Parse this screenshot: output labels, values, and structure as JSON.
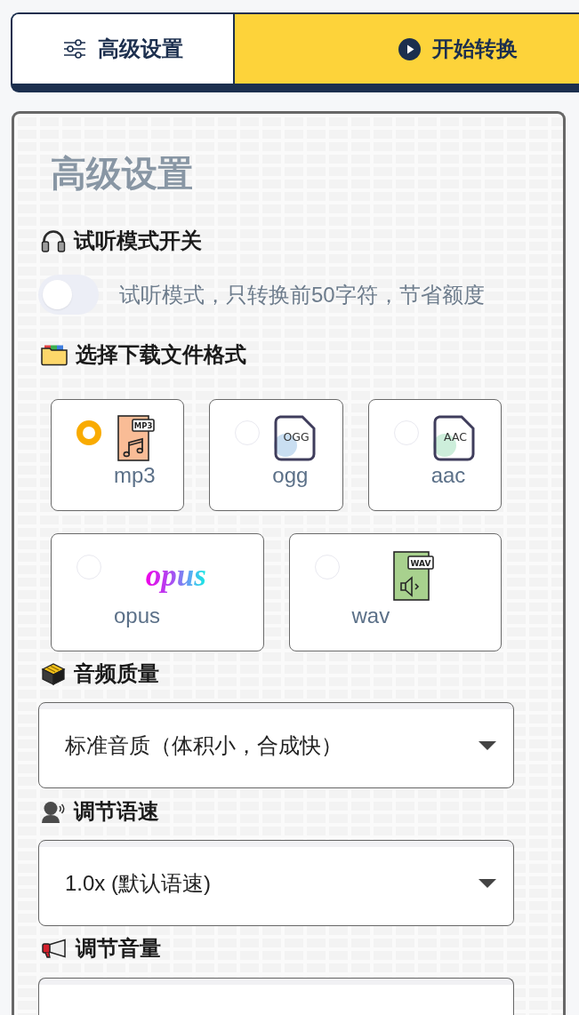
{
  "settings_button": {
    "label": "高级设置"
  },
  "convert_button": {
    "label": "开始转换"
  },
  "settings": {
    "title": "高级设置",
    "preview_mode": {
      "label": "试听模式开关",
      "on": false,
      "description": "试听模式，只转换前50字符，节省额度"
    },
    "file_format": {
      "label": "选择下载文件格式",
      "options": [
        {
          "kind": "note-file",
          "label": "mp3",
          "badge": "MP3",
          "color": "#f9bc96",
          "selected": true
        },
        {
          "kind": "outline-file",
          "label": "ogg",
          "badge": "OGG",
          "color": "#c9def1",
          "selected": false
        },
        {
          "kind": "outline-file",
          "label": "aac",
          "badge": "AAC",
          "color": "#cdeedb",
          "selected": false
        },
        {
          "kind": "wordmark",
          "label": "opus",
          "badge": "opus",
          "selected": false
        },
        {
          "kind": "speaker-file",
          "label": "wav",
          "badge": "WAV",
          "color": "#a8d18e",
          "selected": false
        }
      ]
    },
    "audio_quality": {
      "label": "音频质量",
      "value": "标准音质（体积小，合成快）"
    },
    "speech_rate": {
      "label": "调节语速",
      "value": "1.0x (默认语速)"
    },
    "volume": {
      "label": "调节音量"
    }
  }
}
